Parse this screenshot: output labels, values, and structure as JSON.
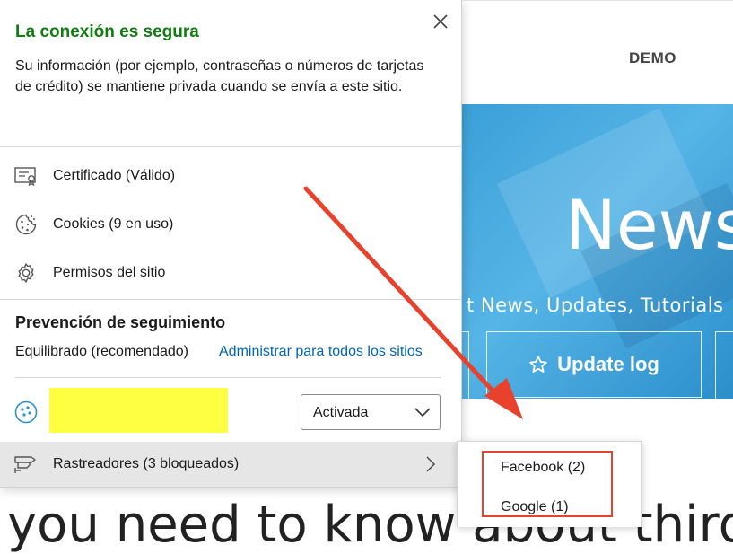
{
  "background_page": {
    "nav_link": "DEMO",
    "hero_title": "News",
    "hero_subtitle": "t News, Updates, Tutorials",
    "hero_button_label": "Update log",
    "bottom_text": "you need to know about third"
  },
  "flyout": {
    "secure_title": "La conexión es segura",
    "secure_description": "Su información (por ejemplo, contraseñas o números de tarjetas de crédito) se mantiene privada cuando se envía a este sitio.",
    "menu_items": [
      {
        "label": "Certificado (Válido)",
        "icon": "certificate-icon"
      },
      {
        "label": "Cookies (9 en uso)",
        "icon": "cookie-icon"
      },
      {
        "label": "Permisos del sitio",
        "icon": "gear-icon"
      }
    ],
    "tracking_prevention": {
      "title": "Prevención de seguimiento",
      "level": "Equilibrado (recomendado)",
      "manage_link": "Administrar para todos los sitios",
      "toggle_value": "Activada"
    },
    "trackers_row": {
      "label": "Rastreadores (3 bloqueados)"
    }
  },
  "trackers_submenu": {
    "items": [
      "Facebook (2)",
      "Google (1)"
    ]
  },
  "colors": {
    "secure_green": "#107c10",
    "link_blue": "#0066b4",
    "annotation_red": "#e8412c",
    "redaction_yellow": "#ffff42",
    "hero_blue": "#3aa0d8"
  }
}
